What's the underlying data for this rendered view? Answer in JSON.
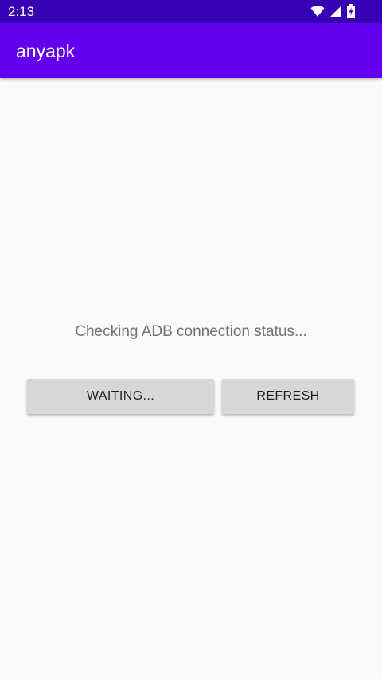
{
  "status_bar": {
    "time": "2:13",
    "icons": [
      "wifi-icon",
      "cell-signal-icon",
      "battery-charging-icon"
    ],
    "background": "#3700b3"
  },
  "app_bar": {
    "title": "anyapk",
    "background": "#6200ee"
  },
  "main": {
    "status_message": "Checking ADB connection status...",
    "buttons": {
      "waiting_label": "WAITING...",
      "refresh_label": "REFRESH"
    },
    "button_color": "#d6d7d7"
  }
}
